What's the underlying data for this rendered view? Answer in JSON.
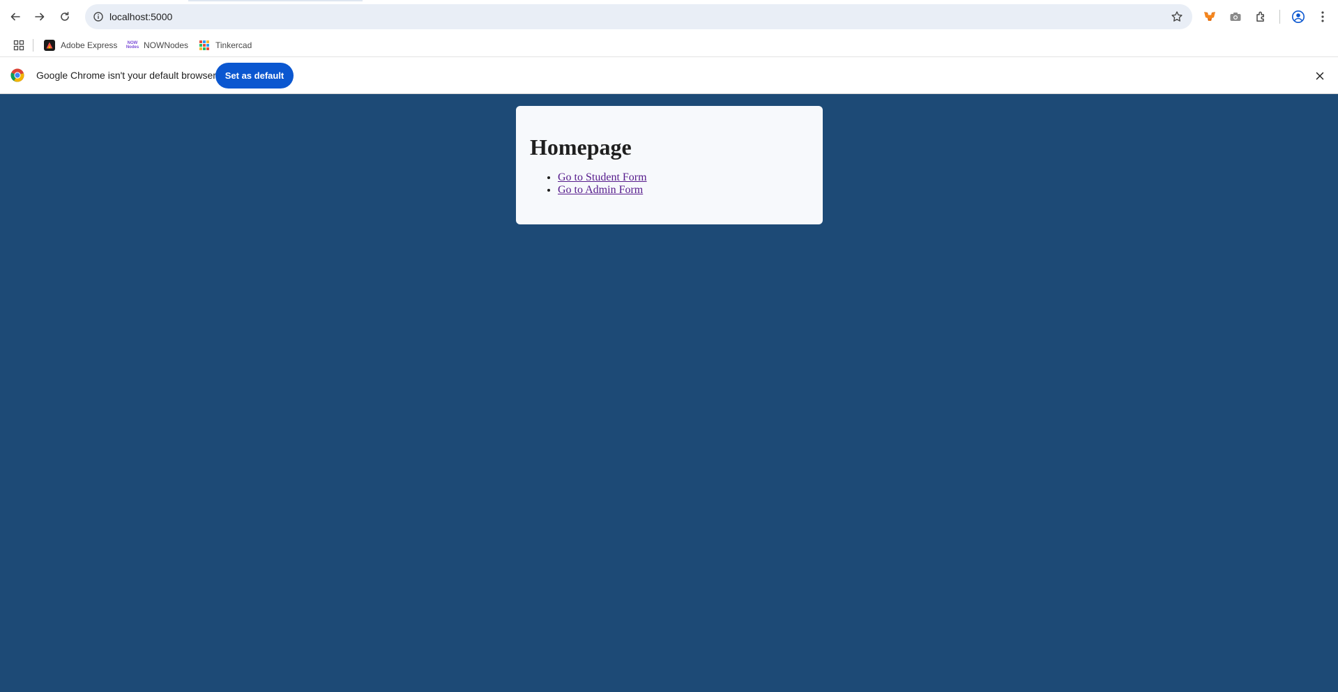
{
  "browser": {
    "url": "localhost:5000",
    "bookmarks": [
      {
        "label": "Adobe Express",
        "icon": "adobe-express-icon"
      },
      {
        "label": "NOWNodes",
        "icon": "nownodes-icon"
      },
      {
        "label": "Tinkercad",
        "icon": "tinkercad-icon"
      }
    ],
    "nownodes_favicon_text": "NOW Nodes"
  },
  "infobar": {
    "message": "Google Chrome isn't your default browser",
    "button_label": "Set as default"
  },
  "page": {
    "title": "Homepage",
    "links": [
      {
        "label": "Go to Student Form"
      },
      {
        "label": "Go to Admin Form"
      }
    ]
  },
  "colors": {
    "page_background": "#1d4a76",
    "card_background": "#f7f9fc",
    "link_visited": "#551a8b",
    "primary_button": "#0b57d0"
  }
}
